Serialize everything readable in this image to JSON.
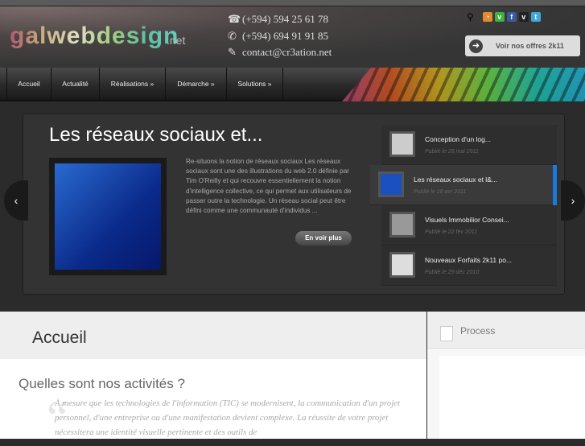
{
  "header": {
    "logo": "galwebdesign",
    "logo_suffix": ".net",
    "phone1": "(+594) 594 25 61 78",
    "phone2": "(+594) 694 91 91 85",
    "email": "contact@cr3ation.net",
    "offers_button": "Voir nos offres 2k11"
  },
  "nav": [
    {
      "label": "Accueil"
    },
    {
      "label": "Actualité"
    },
    {
      "label": "Réalisations »"
    },
    {
      "label": "Démarche »"
    },
    {
      "label": "Solutions »"
    }
  ],
  "slider": {
    "title": "Les réseaux sociaux et...",
    "description": "Re-situons la notion  de réseaux sociaux Les réseaux sociaux sont une des illustrations du web 2.0 définie par Tim O'Reilly et qui recouvre essentiellement la notion d'intelligence collective, ce qui permet aux utilisateurs de passer outre la technologie. Un réseau social peut être défini comme une communauté d'individus ...",
    "more_button": "En voir plus",
    "prev": "‹",
    "next": "›",
    "items": [
      {
        "title": "Conception d'un log...",
        "date": "Publié le 26 mai 2011"
      },
      {
        "title": "Les réseaux sociaux et l&...",
        "date": "Publié le 18 avr 2011"
      },
      {
        "title": "Visuels Immobilior Consei...",
        "date": "Publié le 22 fév 2011"
      },
      {
        "title": "Nouveaux Forfaits 2k11 po...",
        "date": "Publié le 29 déc 2010"
      }
    ]
  },
  "main": {
    "heading": "Accueil",
    "subheading": "Quelles sont nos activités ?",
    "paragraph": "À mesure que les technologies de l'information (TIC) se modernisent, la communication d'un projet personnel, d'une entreprise ou d'une manifestation devient complexe. La réussite de votre projet nécessitera une identité visuelle pertinente et des outils de"
  },
  "sidebar": {
    "title": "Process"
  }
}
